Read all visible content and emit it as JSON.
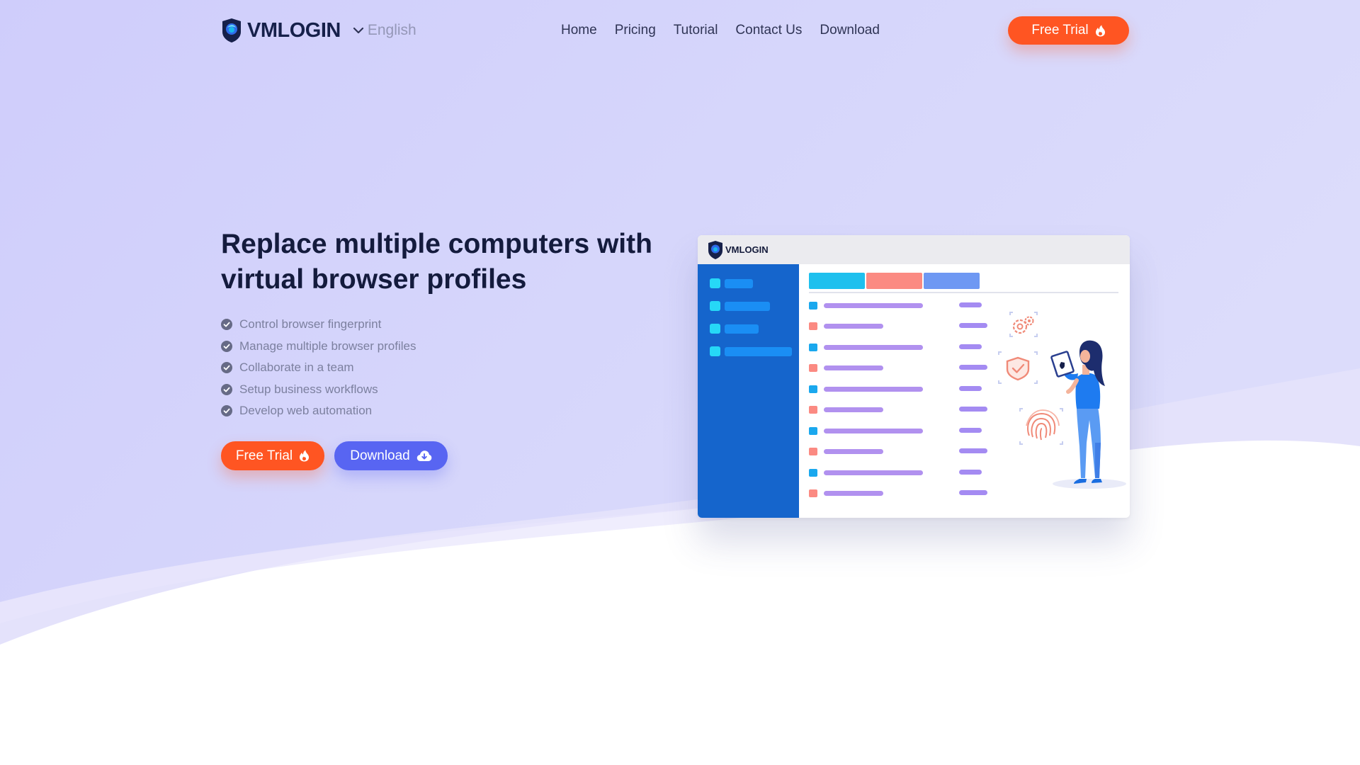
{
  "colors": {
    "accent_orange": "#ff5522",
    "accent_blue": "#5865f2",
    "hero_background": "#d3d2fb",
    "heading": "#141b3d",
    "app_sidebar": "#1565cc"
  },
  "header": {
    "logo_icon": "shield-logo-icon",
    "brand": "VMLOGIN",
    "language": {
      "icon": "chevron-down-icon",
      "selected": "English"
    },
    "nav": [
      {
        "label": "Home"
      },
      {
        "label": "Pricing"
      },
      {
        "label": "Tutorial"
      },
      {
        "label": "Contact Us"
      },
      {
        "label": "Download"
      }
    ],
    "cta": {
      "label": "Free Trial",
      "icon": "flame-icon"
    }
  },
  "hero": {
    "title": "Replace multiple computers with virtual browser profiles",
    "features": [
      "Control browser fingerprint",
      "Manage multiple browser profiles",
      "Collaborate in a team",
      "Setup business workflows",
      "Develop web automation"
    ],
    "feature_icon": "check-circle-icon",
    "primary_button": {
      "label": "Free Trial",
      "icon": "flame-icon"
    },
    "secondary_button": {
      "label": "Download",
      "icon": "cloud-download-icon"
    }
  },
  "mockup": {
    "brand": "VMLOGIN",
    "illustration_icons": [
      "gear-icon",
      "shield-check-icon",
      "fingerprint-icon",
      "woman-with-tablet"
    ]
  }
}
